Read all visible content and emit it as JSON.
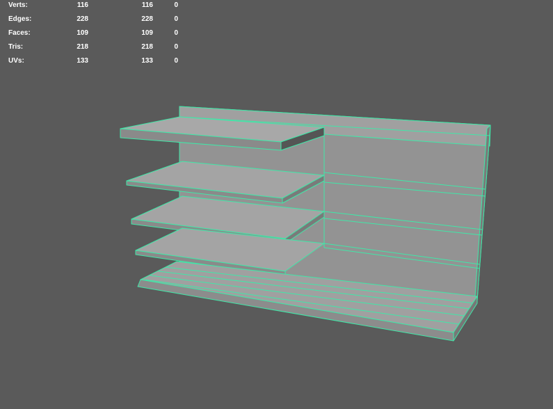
{
  "viewport": {
    "background_color": "#5a5a5a",
    "wireframe_color": "#3fe8a8",
    "face_color": "#9a9a9a"
  },
  "heads_up_display": {
    "rows": [
      {
        "label": "Verts:",
        "values": [
          "116",
          "116",
          "0"
        ]
      },
      {
        "label": "Edges:",
        "values": [
          "228",
          "228",
          "0"
        ]
      },
      {
        "label": "Faces:",
        "values": [
          "109",
          "109",
          "0"
        ]
      },
      {
        "label": "Tris:",
        "values": [
          "218",
          "218",
          "0"
        ]
      },
      {
        "label": "UVs:",
        "values": [
          "133",
          "133",
          "0"
        ]
      }
    ]
  },
  "scene": {
    "object": "shelf-unit-mesh",
    "selected": true
  }
}
